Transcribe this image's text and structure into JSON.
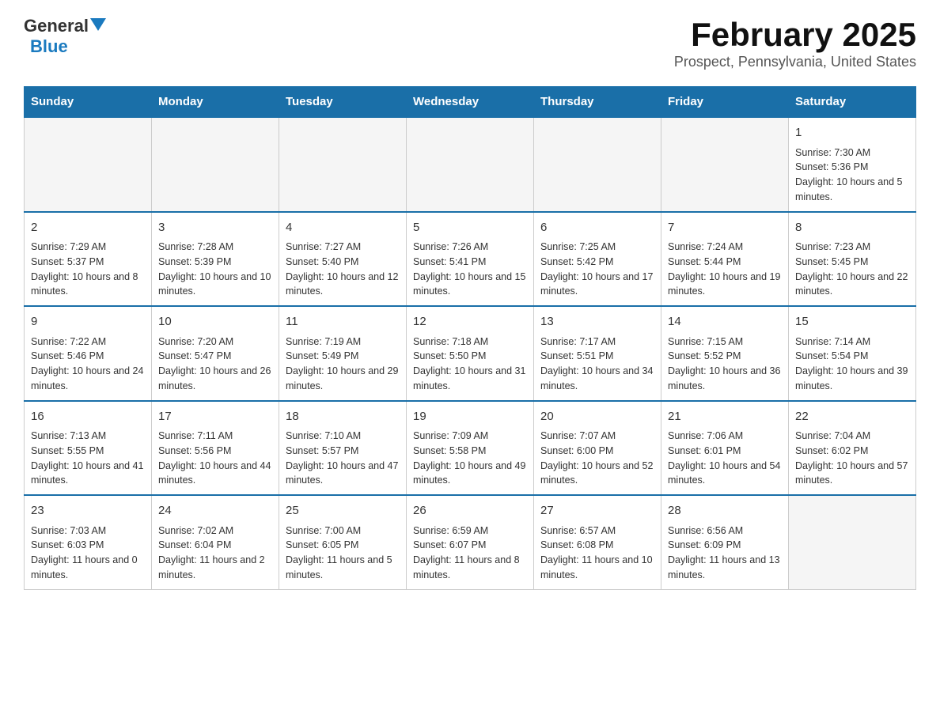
{
  "logo": {
    "general": "General",
    "blue": "Blue"
  },
  "title": "February 2025",
  "subtitle": "Prospect, Pennsylvania, United States",
  "weekdays": [
    "Sunday",
    "Monday",
    "Tuesday",
    "Wednesday",
    "Thursday",
    "Friday",
    "Saturday"
  ],
  "weeks": [
    [
      {
        "day": "",
        "info": ""
      },
      {
        "day": "",
        "info": ""
      },
      {
        "day": "",
        "info": ""
      },
      {
        "day": "",
        "info": ""
      },
      {
        "day": "",
        "info": ""
      },
      {
        "day": "",
        "info": ""
      },
      {
        "day": "1",
        "info": "Sunrise: 7:30 AM\nSunset: 5:36 PM\nDaylight: 10 hours and 5 minutes."
      }
    ],
    [
      {
        "day": "2",
        "info": "Sunrise: 7:29 AM\nSunset: 5:37 PM\nDaylight: 10 hours and 8 minutes."
      },
      {
        "day": "3",
        "info": "Sunrise: 7:28 AM\nSunset: 5:39 PM\nDaylight: 10 hours and 10 minutes."
      },
      {
        "day": "4",
        "info": "Sunrise: 7:27 AM\nSunset: 5:40 PM\nDaylight: 10 hours and 12 minutes."
      },
      {
        "day": "5",
        "info": "Sunrise: 7:26 AM\nSunset: 5:41 PM\nDaylight: 10 hours and 15 minutes."
      },
      {
        "day": "6",
        "info": "Sunrise: 7:25 AM\nSunset: 5:42 PM\nDaylight: 10 hours and 17 minutes."
      },
      {
        "day": "7",
        "info": "Sunrise: 7:24 AM\nSunset: 5:44 PM\nDaylight: 10 hours and 19 minutes."
      },
      {
        "day": "8",
        "info": "Sunrise: 7:23 AM\nSunset: 5:45 PM\nDaylight: 10 hours and 22 minutes."
      }
    ],
    [
      {
        "day": "9",
        "info": "Sunrise: 7:22 AM\nSunset: 5:46 PM\nDaylight: 10 hours and 24 minutes."
      },
      {
        "day": "10",
        "info": "Sunrise: 7:20 AM\nSunset: 5:47 PM\nDaylight: 10 hours and 26 minutes."
      },
      {
        "day": "11",
        "info": "Sunrise: 7:19 AM\nSunset: 5:49 PM\nDaylight: 10 hours and 29 minutes."
      },
      {
        "day": "12",
        "info": "Sunrise: 7:18 AM\nSunset: 5:50 PM\nDaylight: 10 hours and 31 minutes."
      },
      {
        "day": "13",
        "info": "Sunrise: 7:17 AM\nSunset: 5:51 PM\nDaylight: 10 hours and 34 minutes."
      },
      {
        "day": "14",
        "info": "Sunrise: 7:15 AM\nSunset: 5:52 PM\nDaylight: 10 hours and 36 minutes."
      },
      {
        "day": "15",
        "info": "Sunrise: 7:14 AM\nSunset: 5:54 PM\nDaylight: 10 hours and 39 minutes."
      }
    ],
    [
      {
        "day": "16",
        "info": "Sunrise: 7:13 AM\nSunset: 5:55 PM\nDaylight: 10 hours and 41 minutes."
      },
      {
        "day": "17",
        "info": "Sunrise: 7:11 AM\nSunset: 5:56 PM\nDaylight: 10 hours and 44 minutes."
      },
      {
        "day": "18",
        "info": "Sunrise: 7:10 AM\nSunset: 5:57 PM\nDaylight: 10 hours and 47 minutes."
      },
      {
        "day": "19",
        "info": "Sunrise: 7:09 AM\nSunset: 5:58 PM\nDaylight: 10 hours and 49 minutes."
      },
      {
        "day": "20",
        "info": "Sunrise: 7:07 AM\nSunset: 6:00 PM\nDaylight: 10 hours and 52 minutes."
      },
      {
        "day": "21",
        "info": "Sunrise: 7:06 AM\nSunset: 6:01 PM\nDaylight: 10 hours and 54 minutes."
      },
      {
        "day": "22",
        "info": "Sunrise: 7:04 AM\nSunset: 6:02 PM\nDaylight: 10 hours and 57 minutes."
      }
    ],
    [
      {
        "day": "23",
        "info": "Sunrise: 7:03 AM\nSunset: 6:03 PM\nDaylight: 11 hours and 0 minutes."
      },
      {
        "day": "24",
        "info": "Sunrise: 7:02 AM\nSunset: 6:04 PM\nDaylight: 11 hours and 2 minutes."
      },
      {
        "day": "25",
        "info": "Sunrise: 7:00 AM\nSunset: 6:05 PM\nDaylight: 11 hours and 5 minutes."
      },
      {
        "day": "26",
        "info": "Sunrise: 6:59 AM\nSunset: 6:07 PM\nDaylight: 11 hours and 8 minutes."
      },
      {
        "day": "27",
        "info": "Sunrise: 6:57 AM\nSunset: 6:08 PM\nDaylight: 11 hours and 10 minutes."
      },
      {
        "day": "28",
        "info": "Sunrise: 6:56 AM\nSunset: 6:09 PM\nDaylight: 11 hours and 13 minutes."
      },
      {
        "day": "",
        "info": ""
      }
    ]
  ]
}
